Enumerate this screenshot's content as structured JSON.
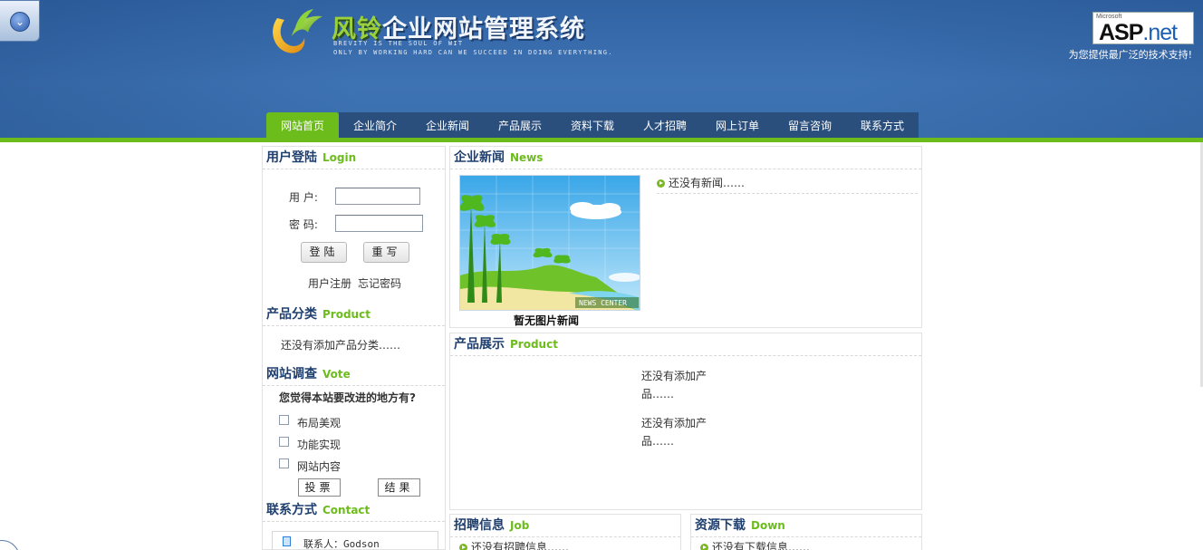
{
  "header": {
    "title_part1": "风铃",
    "title_part2": "企业网站管理系统",
    "slogan_line1": "BREVITY IS THE SOUL OF WIT",
    "slogan_line2": "ONLY BY WORKING HARD CAN WE SUCCEED IN DOING EVERYTHING.",
    "badge_ms": "Microsoft",
    "badge_asp": "ASP",
    "badge_net": ".net",
    "tech_support": "为您提供最广泛的技术支持!"
  },
  "nav": {
    "items": [
      {
        "label": "网站首页",
        "active": true
      },
      {
        "label": "企业简介"
      },
      {
        "label": "企业新闻"
      },
      {
        "label": "产品展示"
      },
      {
        "label": "资料下载"
      },
      {
        "label": "人才招聘"
      },
      {
        "label": "网上订单"
      },
      {
        "label": "留言咨询"
      },
      {
        "label": "联系方式"
      }
    ]
  },
  "login": {
    "title_cn": "用户登陆",
    "title_en": "Login",
    "user_label": "用 户:",
    "password_label": "密 码:",
    "user_value": "",
    "password_value": "",
    "login_button": "登陆",
    "reset_button": "重写",
    "register_link": "用户注册",
    "forgot_link": "忘记密码"
  },
  "product_category": {
    "title_cn": "产品分类",
    "title_en": "Product",
    "empty_text": "还没有添加产品分类……"
  },
  "vote": {
    "title_cn": "网站调查",
    "title_en": "Vote",
    "question": "您觉得本站要改进的地方有?",
    "options": [
      "布局美观",
      "功能实现",
      "网站内容"
    ],
    "vote_button": "投票",
    "result_button": "结果"
  },
  "contact": {
    "title_cn": "联系方式",
    "title_en": "Contact",
    "person": "联系人：Godson"
  },
  "news": {
    "title_cn": "企业新闻",
    "title_en": "News",
    "image_caption": "暂无图片新闻",
    "image_badge": "NEWS CENTER",
    "empty_text": "还没有新闻……"
  },
  "products": {
    "title_cn": "产品展示",
    "title_en": "Product",
    "empty_1_line1": "还没有添加产",
    "empty_1_line2": "品……",
    "empty_2_line1": "还没有添加产",
    "empty_2_line2": "品……"
  },
  "jobs": {
    "title_cn": "招聘信息",
    "title_en": "Job",
    "empty_text": "还没有招聘信息……"
  },
  "downloads": {
    "title_cn": "资源下载",
    "title_en": "Down",
    "empty_text": "还没有下载信息……"
  },
  "colors": {
    "header_blue": "#3e73b3",
    "nav_blue": "#2b4f7d",
    "accent_green": "#6cbc1c",
    "title_navy": "#1f3f6f"
  }
}
